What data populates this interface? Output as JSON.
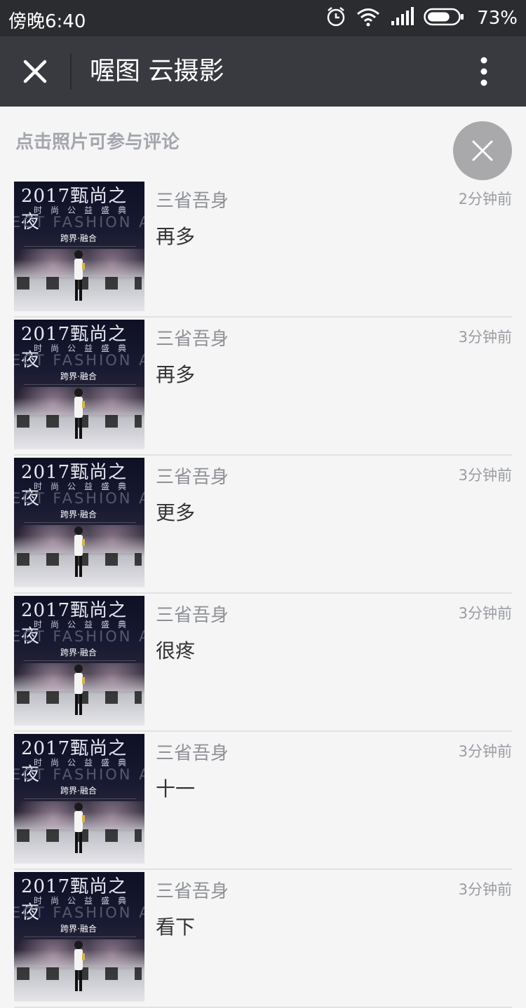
{
  "status_bar": {
    "time": "傍晚6:40",
    "battery_percent": "73%",
    "icons": [
      "alarm-icon",
      "wifi-icon",
      "signal-icon",
      "battery-icon"
    ],
    "battery_level": 0.73
  },
  "nav": {
    "title": "喔图 云摄影",
    "icons": [
      "close-icon",
      "more-vertical-icon"
    ]
  },
  "hint": "点击照片可参与评论",
  "thumbnail": {
    "title": "2017甄尚之夜",
    "subtitle": "时尚公益盛典",
    "band_text": "ECT FASHION AWA",
    "motto": "跨界·融合"
  },
  "comments": [
    {
      "user": "三省吾身",
      "time": "2分钟前",
      "text": "再多"
    },
    {
      "user": "三省吾身",
      "time": "3分钟前",
      "text": "再多"
    },
    {
      "user": "三省吾身",
      "time": "3分钟前",
      "text": "更多"
    },
    {
      "user": "三省吾身",
      "time": "3分钟前",
      "text": "很疼"
    },
    {
      "user": "三省吾身",
      "time": "3分钟前",
      "text": "十一"
    },
    {
      "user": "三省吾身",
      "time": "3分钟前",
      "text": "看下"
    }
  ],
  "colors": {
    "status_bar_bg": "#2b2c2f",
    "nav_bg": "#393a3f",
    "page_bg": "#f5f5f5",
    "float_button_bg": "#a9a9ab"
  }
}
